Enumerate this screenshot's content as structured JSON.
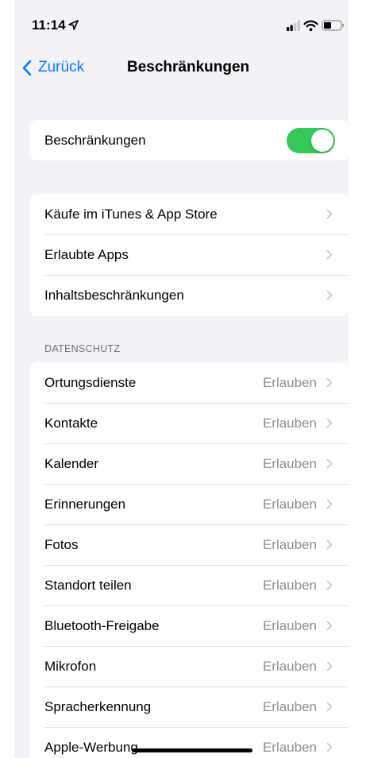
{
  "status_bar": {
    "time": "11:14"
  },
  "nav": {
    "back_label": "Zurück",
    "title": "Beschränkungen"
  },
  "toggle_group": {
    "label": "Beschränkungen",
    "enabled": true,
    "color_on": "#34c759"
  },
  "menu_group": {
    "items": [
      {
        "label": "Käufe im iTunes & App Store"
      },
      {
        "label": "Erlaubte Apps"
      },
      {
        "label": "Inhaltsbeschränkungen"
      }
    ]
  },
  "privacy": {
    "header": "DATENSCHUTZ",
    "items": [
      {
        "label": "Ortungsdienste",
        "value": "Erlauben"
      },
      {
        "label": "Kontakte",
        "value": "Erlauben"
      },
      {
        "label": "Kalender",
        "value": "Erlauben"
      },
      {
        "label": "Erinnerungen",
        "value": "Erlauben"
      },
      {
        "label": "Fotos",
        "value": "Erlauben"
      },
      {
        "label": "Standort teilen",
        "value": "Erlauben"
      },
      {
        "label": "Bluetooth-Freigabe",
        "value": "Erlauben"
      },
      {
        "label": "Mikrofon",
        "value": "Erlauben"
      },
      {
        "label": "Spracherkennung",
        "value": "Erlauben"
      },
      {
        "label": "Apple-Werbung",
        "value": "Erlauben"
      }
    ]
  },
  "colors": {
    "accent": "#0a7aff",
    "background": "#f2f2f7",
    "secondary_text": "#8e8e93"
  }
}
